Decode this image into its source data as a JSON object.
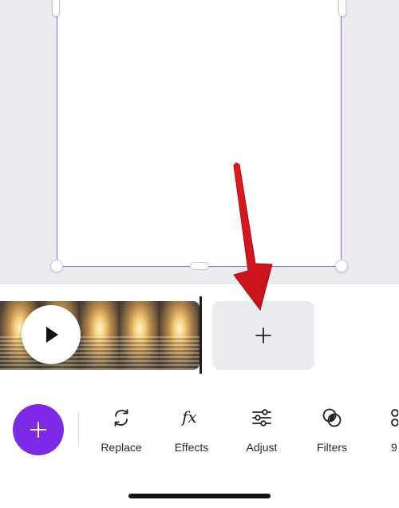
{
  "timeline": {
    "play_icon": "play-icon",
    "add_clip_icon": "plus-icon"
  },
  "toolbar": {
    "fab_icon": "plus-icon",
    "fab_color": "#7d2ae8",
    "items": [
      {
        "label": "Replace",
        "icon": "replace-icon"
      },
      {
        "label": "Effects",
        "icon": "fx-icon"
      },
      {
        "label": "Adjust",
        "icon": "sliders-icon"
      },
      {
        "label": "Filters",
        "icon": "filters-icon"
      },
      {
        "label": "9",
        "icon": "more-tool-icon"
      }
    ]
  },
  "annotation": {
    "arrow_color": "#e3191f"
  },
  "colors": {
    "selection": "#8b5cf6",
    "canvas_bg": "#ebecf0"
  }
}
